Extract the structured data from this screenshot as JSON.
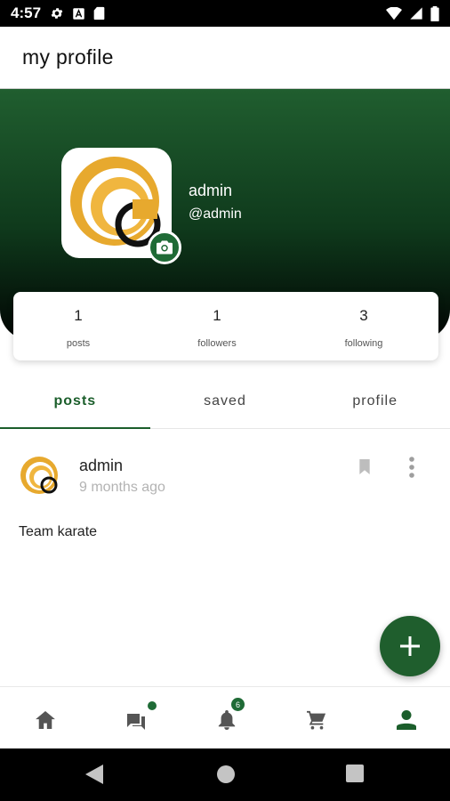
{
  "status_bar": {
    "time": "4:57",
    "icons": [
      "gear-icon",
      "a-icon",
      "sd-card-icon",
      "wifi-icon",
      "signal-icon",
      "battery-icon"
    ]
  },
  "app_bar": {
    "title": "my profile"
  },
  "profile": {
    "name": "admin",
    "handle": "@admin",
    "avatar_icon": "rings-logo-icon",
    "camera_icon": "camera-icon",
    "accent": "#1f6b36",
    "header_gradient": [
      "#205e2f",
      "#010503"
    ]
  },
  "stats": [
    {
      "value": "1",
      "label": "posts"
    },
    {
      "value": "1",
      "label": "followers"
    },
    {
      "value": "3",
      "label": "following"
    }
  ],
  "tabs": [
    {
      "label": "posts",
      "active": true
    },
    {
      "label": "saved",
      "active": false
    },
    {
      "label": "profile",
      "active": false
    }
  ],
  "post": {
    "author": "admin",
    "time": "9 months ago",
    "text": "Team karate",
    "bookmark_icon": "bookmark-icon",
    "more_icon": "more-vert-icon"
  },
  "fab": {
    "icon": "plus-icon"
  },
  "bottom_nav": {
    "items": [
      {
        "icon": "home-icon",
        "active": false
      },
      {
        "icon": "chat-icon",
        "active": false,
        "dot": true
      },
      {
        "icon": "bell-icon",
        "active": false,
        "badge": "6"
      },
      {
        "icon": "cart-icon",
        "active": false
      },
      {
        "icon": "person-icon",
        "active": true
      }
    ]
  },
  "system_nav": {
    "icons": [
      "back-icon",
      "home-circle-icon",
      "recents-icon"
    ]
  }
}
